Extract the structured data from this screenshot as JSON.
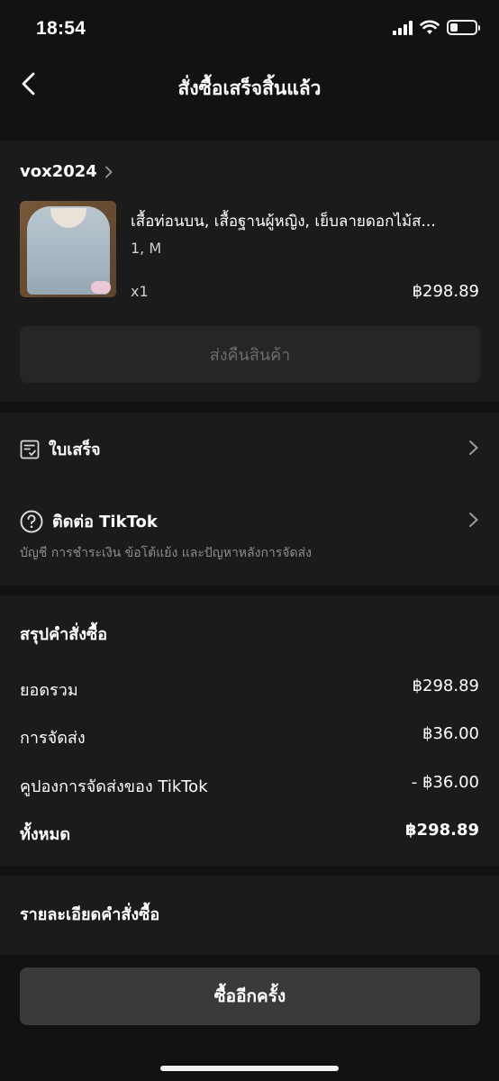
{
  "status_bar": {
    "time": "18:54"
  },
  "header": {
    "title": "สั่งซื้อเสร็จสิ้นแล้ว"
  },
  "order": {
    "shop_name": "vox2024",
    "product_title": "เสื้อท่อนบน, เสื้อฐานผู้หญิง, เย็บลายดอกไม้ส...",
    "variant": "1, M",
    "quantity": "x1",
    "price": "฿298.89",
    "return_label": "ส่งคืนสินค้า"
  },
  "links": {
    "receipt_label": "ใบเสร็จ",
    "contact_label": "ติดต่อ TikTok",
    "contact_sub": "บัญชี การชำระเงิน ข้อโต้แย้ง และปัญหาหลังการจัดส่ง"
  },
  "summary": {
    "title": "สรุปคำสั่งซื้อ",
    "rows": [
      {
        "label": "ยอดรวม",
        "value": "฿298.89"
      },
      {
        "label": "การจัดส่ง",
        "value": "฿36.00"
      },
      {
        "label": "คูปองการจัดส่งของ TikTok",
        "value": "- ฿36.00"
      },
      {
        "label": "ทั้งหมด",
        "value": "฿298.89"
      }
    ]
  },
  "details": {
    "title": "รายละเอียดคำสั่งซื้อ"
  },
  "footer": {
    "rebuy_label": "ซื้ออีกครั้ง"
  },
  "colors": {
    "background": "#121212",
    "card": "#1b1b1b",
    "button": "#3a3a3a"
  }
}
